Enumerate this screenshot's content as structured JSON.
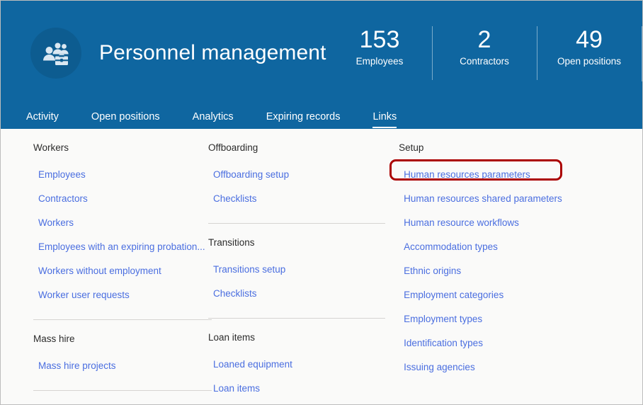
{
  "header": {
    "title": "Personnel management",
    "icon": "people-briefcase-icon",
    "brand_color": "#0f66a0",
    "stats": [
      {
        "value": "153",
        "label": "Employees"
      },
      {
        "value": "2",
        "label": "Contractors"
      },
      {
        "value": "49",
        "label": "Open positions"
      }
    ]
  },
  "tabs": [
    {
      "label": "Activity",
      "active": false
    },
    {
      "label": "Open positions",
      "active": false
    },
    {
      "label": "Analytics",
      "active": false
    },
    {
      "label": "Expiring records",
      "active": false
    },
    {
      "label": "Links",
      "active": true
    }
  ],
  "link_color": "#4a6ee0",
  "highlight_color": "#ab0000",
  "columns": [
    {
      "groups": [
        {
          "title": "Workers",
          "links": [
            "Employees",
            "Contractors",
            "Workers",
            "Employees with an expiring probation...",
            "Workers without employment",
            "Worker user requests"
          ]
        },
        {
          "title": "Mass hire",
          "links": [
            "Mass hire projects"
          ]
        }
      ]
    },
    {
      "groups": [
        {
          "title": "Offboarding",
          "links": [
            "Offboarding setup",
            "Checklists"
          ]
        },
        {
          "title": "Transitions",
          "links": [
            "Transitions setup",
            "Checklists"
          ]
        },
        {
          "title": "Loan items",
          "links": [
            "Loaned equipment",
            "Loan items"
          ]
        }
      ]
    },
    {
      "groups": [
        {
          "title": "Setup",
          "links": [
            "Human resources parameters",
            "Human resources shared parameters",
            "Human resource workflows",
            "Accommodation types",
            "Ethnic origins",
            "Employment categories",
            "Employment types",
            "Identification types",
            "Issuing agencies"
          ],
          "highlighted_link": "Human resources parameters"
        }
      ]
    }
  ]
}
